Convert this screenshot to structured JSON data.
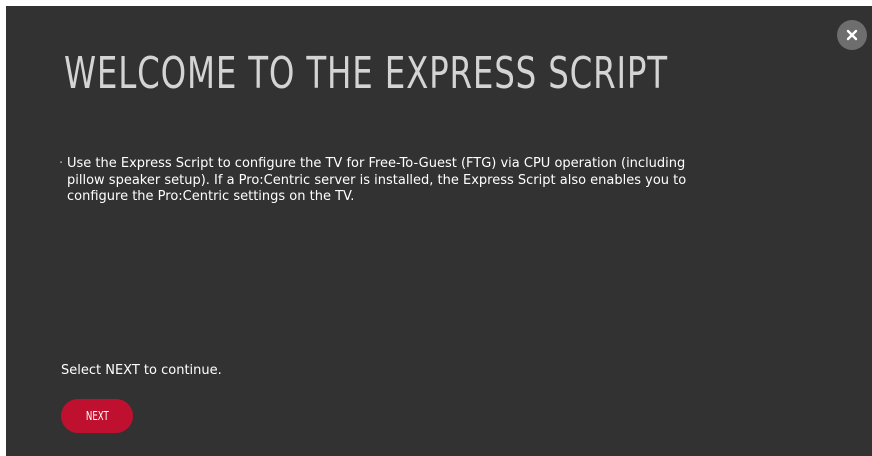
{
  "title": "WELCOME TO THE EXPRESS SCRIPT",
  "description": {
    "bullet": "·",
    "text": "Use the Express Script to configure the TV for Free-To-Guest (FTG) via CPU operation (including pillow speaker setup). If a Pro:Centric server is installed, the Express Script also enables you to configure the Pro:Centric settings on the TV."
  },
  "prompt": "Select NEXT to continue.",
  "next_button": {
    "label": "NEXT"
  },
  "close_button": {
    "icon": "close-icon"
  },
  "colors": {
    "background": "#333232",
    "accent": "#c0102f",
    "close_bg": "#6e6e6e",
    "title": "#d4d4d4",
    "text": "#ffffff"
  }
}
